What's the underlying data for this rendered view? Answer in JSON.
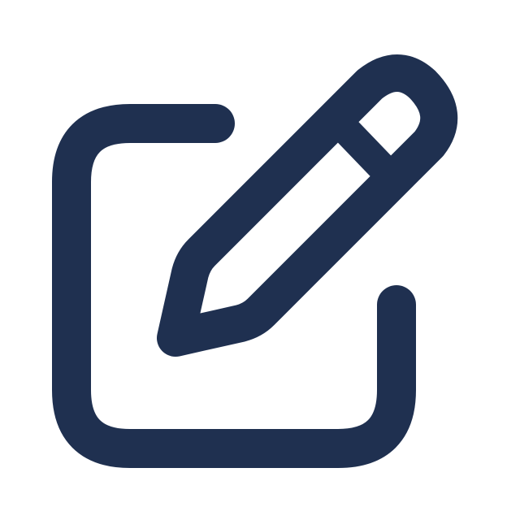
{
  "icon": {
    "name": "edit-icon",
    "parts": [
      "square-frame",
      "pencil"
    ],
    "color": "#1f3050",
    "background": "#ffffff"
  }
}
